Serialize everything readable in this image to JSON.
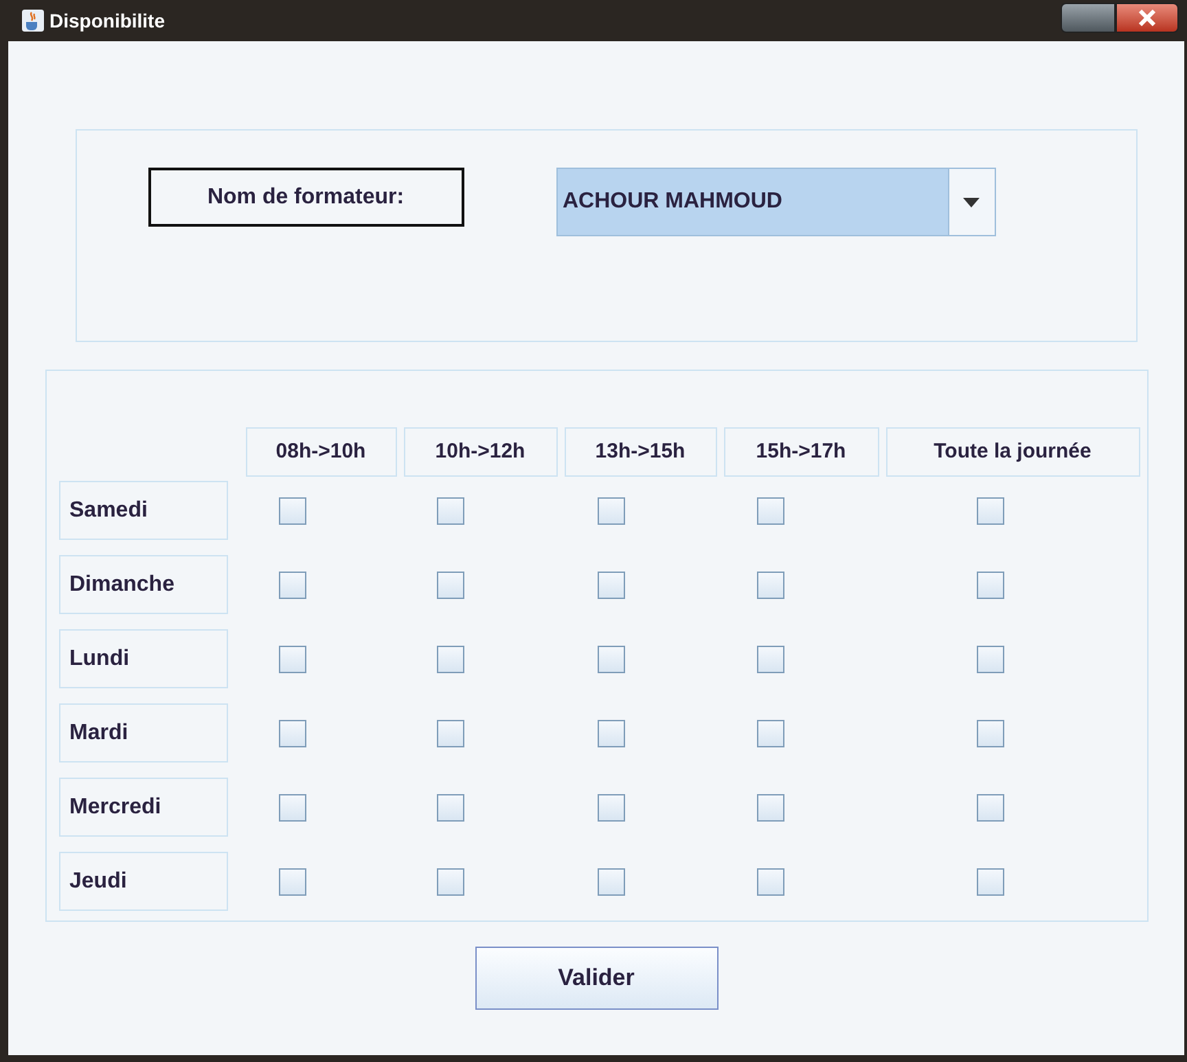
{
  "window": {
    "title": "Disponibilite"
  },
  "trainer": {
    "label": "Nom de formateur:",
    "value": "ACHOUR MAHMOUD"
  },
  "columns": [
    "08h->10h",
    "10h->12h",
    "13h->15h",
    "15h->17h",
    "Toute la journée"
  ],
  "rows": [
    {
      "day": "Samedi",
      "checks": [
        false,
        false,
        false,
        false,
        false
      ]
    },
    {
      "day": "Dimanche",
      "checks": [
        false,
        false,
        false,
        false,
        false
      ]
    },
    {
      "day": "Lundi",
      "checks": [
        false,
        false,
        false,
        false,
        false
      ]
    },
    {
      "day": "Mardi",
      "checks": [
        false,
        false,
        false,
        false,
        false
      ]
    },
    {
      "day": "Mercredi",
      "checks": [
        false,
        false,
        false,
        false,
        false
      ]
    },
    {
      "day": "Jeudi",
      "checks": [
        false,
        false,
        false,
        false,
        false
      ]
    }
  ],
  "button": "Valider"
}
